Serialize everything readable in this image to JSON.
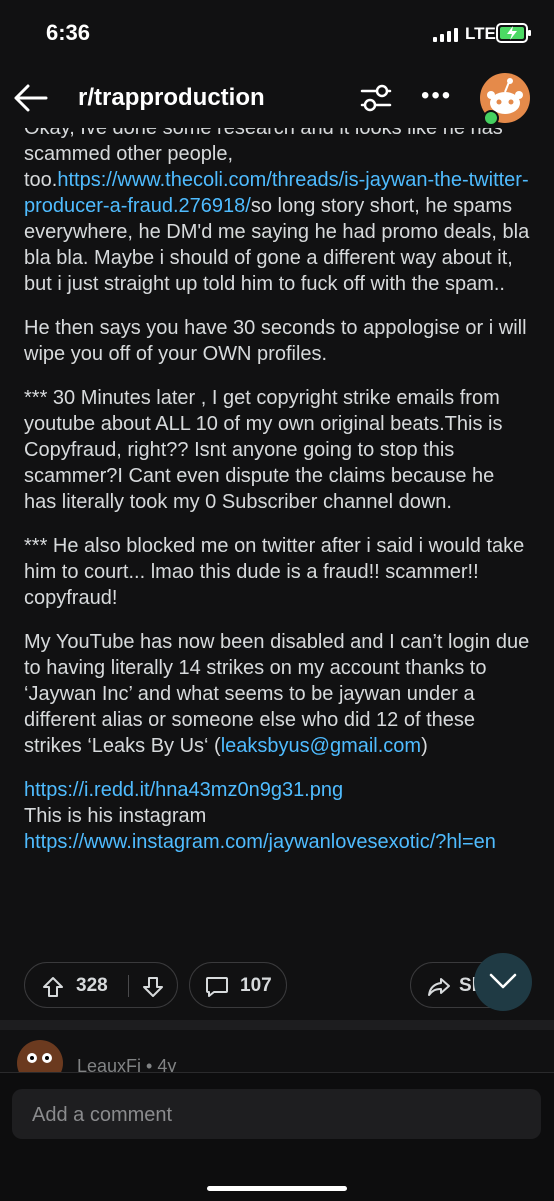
{
  "status": {
    "time": "6:36",
    "network": "LTE"
  },
  "header": {
    "subreddit": "r/trapproduction"
  },
  "post": {
    "paragraphs": [
      [
        {
          "text": "Okay, Ive done some research and it looks like he has scammed other people, too.",
          "link": false
        },
        {
          "text": "https://www.thecoli.com/threads/is-jaywan-the-twitter-producer-a-fraud.276918/",
          "link": true
        },
        {
          "text": "so long story short, he spams everywhere, he DM'd me saying he had promo deals, bla bla bla. Maybe i should of gone a different way about it, but i just straight up told him to fuck off with the spam..",
          "link": false
        }
      ],
      [
        {
          "text": "He then says you have 30 seconds to appologise or i will wipe you off of your OWN profiles.",
          "link": false
        }
      ],
      [
        {
          "text": "*** 30 Minutes later , I get copyright strike emails from youtube about ALL 10 of my own original beats.This is Copyfraud, right?? Isnt anyone going to stop this scammer?I Cant even dispute the claims because he has literally took my 0 Subscriber channel down.",
          "link": false
        }
      ],
      [
        {
          "text": "*** He also blocked me on  twitter after i said i would take him to court... lmao this dude is a fraud!! scammer!! copyfraud!",
          "link": false
        }
      ],
      [
        {
          "text": "My YouTube has now been disabled and I can’t login due to having literally 14 strikes on my account thanks to ‘Jaywan Inc’ and what seems to be jaywan under a different alias or someone else who did 12 of these strikes ‘Leaks By Us‘ (",
          "link": false
        },
        {
          "text": "leaksbyus@gmail.com",
          "link": true
        },
        {
          "text": ")",
          "link": false
        }
      ],
      [
        {
          "text": "https://i.redd.it/hna43mz0n9g31.png",
          "link": true
        },
        {
          "text": "\nThis is his instagram  ",
          "link": false
        },
        {
          "text": "https://www.instagram.com/jaywanlovesexotic/?hl=en",
          "link": true
        }
      ]
    ]
  },
  "actions": {
    "upvotes": "328",
    "comments": "107",
    "share_label": "Sl"
  },
  "comment_preview": {
    "author": "LeauxFi • 4y"
  },
  "composer": {
    "placeholder": "Add a comment"
  }
}
